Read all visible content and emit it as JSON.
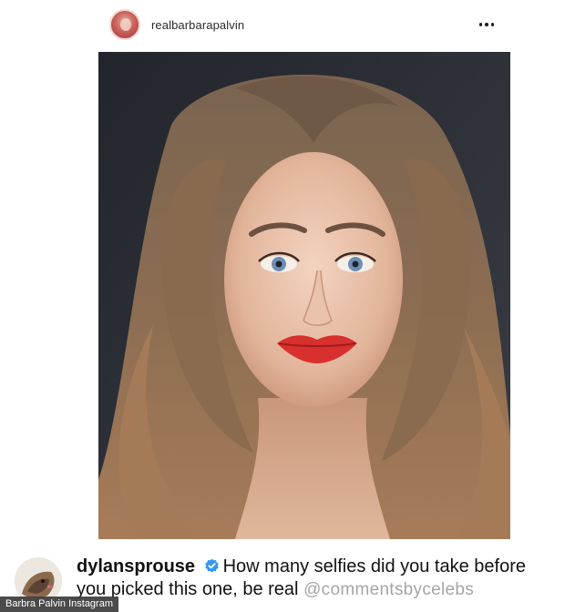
{
  "post": {
    "username": "realbarbarapalvin",
    "more_icon": "more-horizontal-icon"
  },
  "comment": {
    "username": "dylansprouse",
    "verified_icon": "verified-badge-icon",
    "text": "How many selfies did you take before you picked this one, be real",
    "watermark": "@commentsbycelebs"
  },
  "caption": {
    "credit": "Barbra Palvin Instagram"
  },
  "colors": {
    "verified_blue": "#3897f0",
    "lip_red": "#d8302e",
    "photo_background": "#2a2c33"
  }
}
